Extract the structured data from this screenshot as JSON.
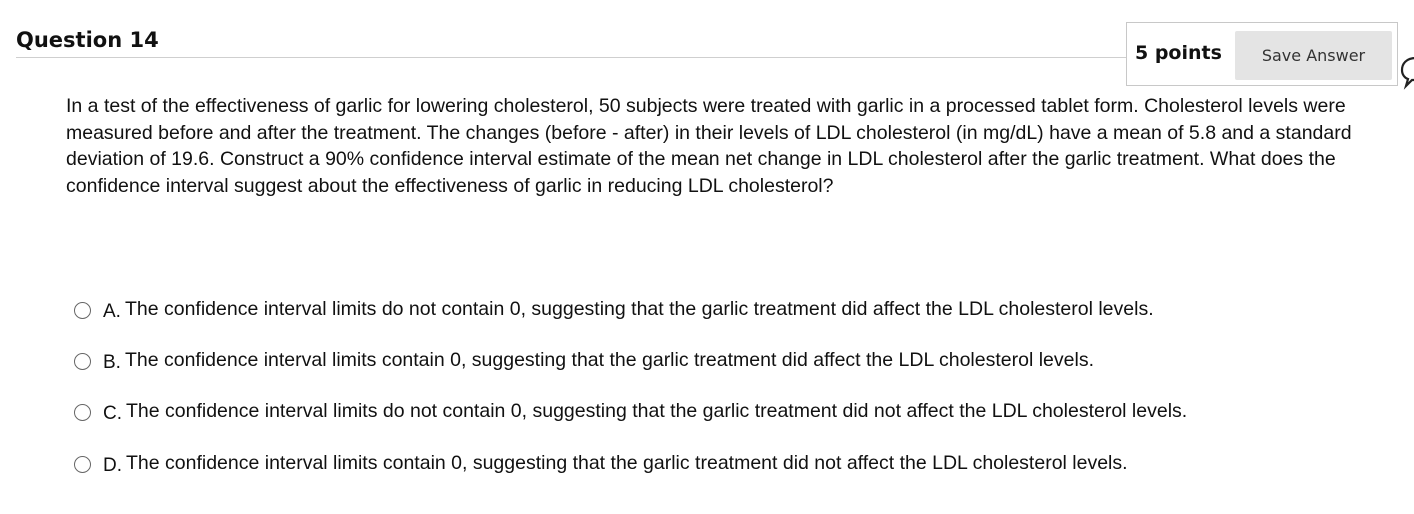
{
  "question": {
    "title": "Question 14",
    "points": "5 points",
    "save_label": "Save Answer",
    "text": "In a test of the effectiveness of garlic for lowering cholesterol, 50 subjects were treated with garlic in a processed tablet form. Cholesterol levels were measured before and after the treatment. The changes (before - after) in their levels of LDL cholesterol (in mg/dL) have a mean of 5.8 and a standard deviation of 19.6. Construct a 90% confidence interval estimate of the mean net change in LDL cholesterol after the garlic treatment. What does the confidence interval suggest about the effectiveness of garlic in reducing LDL cholesterol?"
  },
  "options": [
    {
      "letter": "A.",
      "text": "The confidence interval limits do not contain 0, suggesting that the garlic treatment did affect the LDL cholesterol levels."
    },
    {
      "letter": "B.",
      "text": "The confidence interval limits contain 0, suggesting that the garlic treatment did affect the LDL cholesterol levels."
    },
    {
      "letter": "C.",
      "text": "The confidence interval limits do not contain 0, suggesting that the garlic treatment did not affect the LDL cholesterol levels."
    },
    {
      "letter": "D.",
      "text": "The confidence interval limits contain 0, suggesting that the garlic treatment did not affect the LDL cholesterol levels."
    }
  ],
  "icons": {
    "chat": "chat-bubble-icon",
    "radio": "radio-unselected-icon"
  },
  "colors": {
    "button_bg": "#e4e4e4",
    "border": "#c8c8c8"
  }
}
